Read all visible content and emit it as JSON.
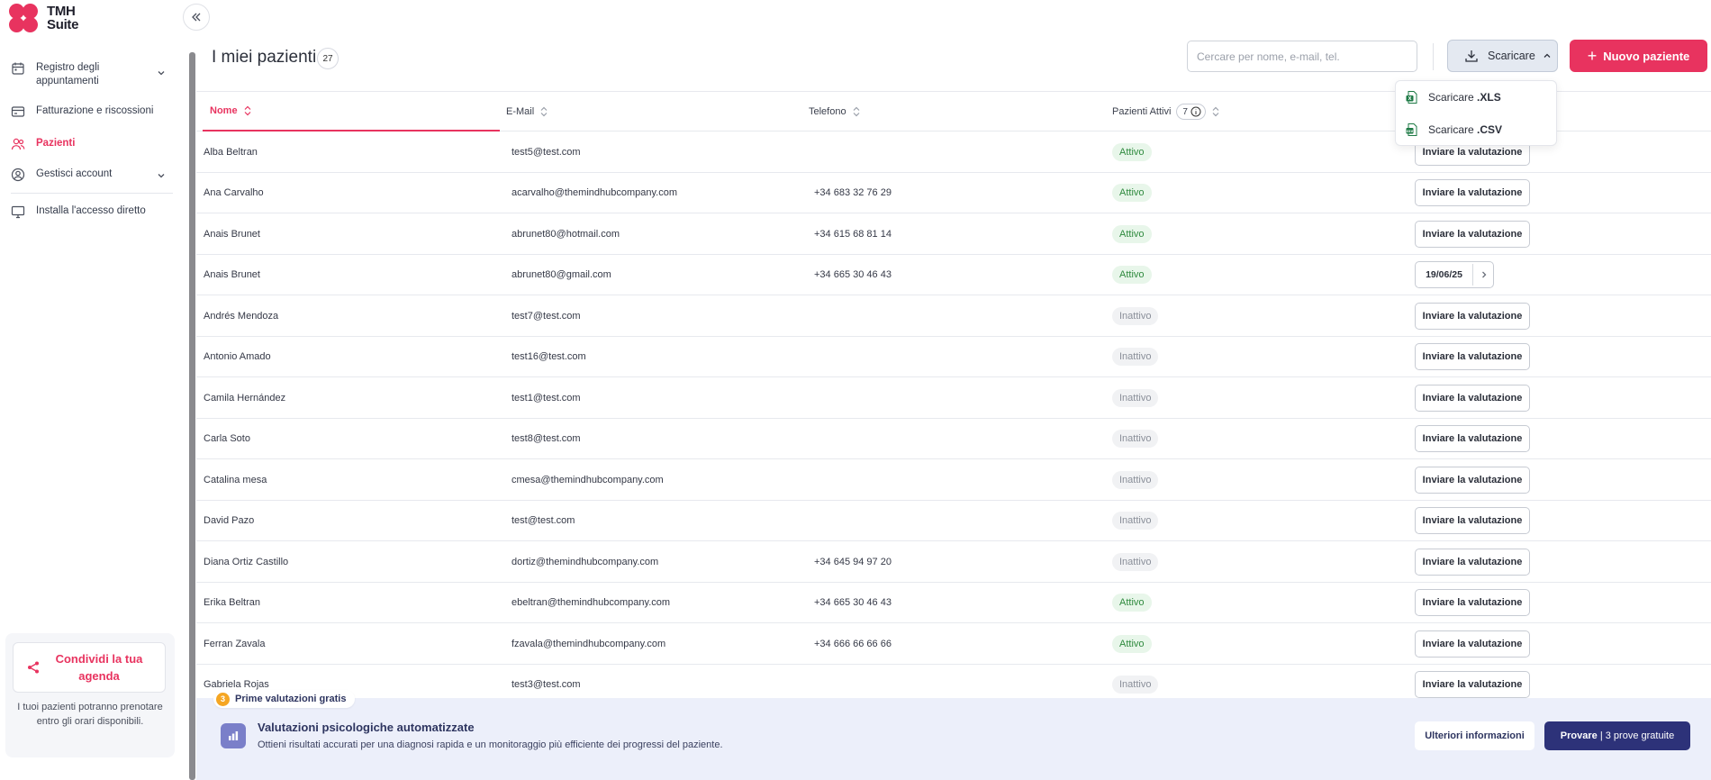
{
  "app": {
    "logo_line1": "TMH",
    "logo_line2": "Suite",
    "brand_color": "#e8335f"
  },
  "sidebar": {
    "items": [
      {
        "label": "Registro degli appuntamenti",
        "icon": "calendar-icon",
        "has_chevron": true
      },
      {
        "label": "Fatturazione e riscossioni",
        "icon": "card-icon",
        "has_chevron": false
      },
      {
        "label": "Pazienti",
        "icon": "users-icon",
        "active": true
      },
      {
        "label": "Gestisci account",
        "icon": "account-icon",
        "has_chevron": true
      },
      {
        "label": "Installa l'accesso diretto",
        "icon": "monitor-icon"
      }
    ],
    "share": {
      "title": "Condividi la tua agenda",
      "text": "I tuoi pazienti potranno prenotare entro gli orari disponibili."
    }
  },
  "header": {
    "title": "I miei pazienti",
    "count": "27",
    "search_placeholder": "Cercare per nome, e-mail, tel.",
    "download_label": "Scaricare",
    "new_patient_label": "Nuovo paziente"
  },
  "download_menu": {
    "items": [
      {
        "prefix": "Scaricare ",
        "ext": ".XLS",
        "icon": "xls-file-icon"
      },
      {
        "prefix": "Scaricare ",
        "ext": ".CSV",
        "icon": "csv-file-icon"
      }
    ]
  },
  "table": {
    "columns": {
      "name": "Nome",
      "email": "E-Mail",
      "phone": "Telefono",
      "active": "Pazienti Attivi",
      "active_count": "7"
    },
    "eval_label": "Inviare la valutazione",
    "rows": [
      {
        "name": "Alba Beltran",
        "email": "test5@test.com",
        "phone": "",
        "status": "Attivo",
        "active": true,
        "action": "eval"
      },
      {
        "name": "Ana Carvalho",
        "email": "acarvalho@themindhubcompany.com",
        "phone": "+34 683 32 76 29",
        "status": "Attivo",
        "active": true,
        "action": "eval"
      },
      {
        "name": "Anais Brunet",
        "email": "abrunet80@hotmail.com",
        "phone": "+34 615 68 81 14",
        "status": "Attivo",
        "active": true,
        "action": "eval"
      },
      {
        "name": "Anais Brunet",
        "email": "abrunet80@gmail.com",
        "phone": "+34 665 30 46 43",
        "status": "Attivo",
        "active": true,
        "action": "date",
        "date": "19/06/25"
      },
      {
        "name": "Andrés Mendoza",
        "email": "test7@test.com",
        "phone": "",
        "status": "Inattivo",
        "active": false,
        "action": "eval"
      },
      {
        "name": "Antonio Amado",
        "email": "test16@test.com",
        "phone": "",
        "status": "Inattivo",
        "active": false,
        "action": "eval"
      },
      {
        "name": "Camila Hernández",
        "email": "test1@test.com",
        "phone": "",
        "status": "Inattivo",
        "active": false,
        "action": "eval"
      },
      {
        "name": "Carla Soto",
        "email": "test8@test.com",
        "phone": "",
        "status": "Inattivo",
        "active": false,
        "action": "eval"
      },
      {
        "name": "Catalina mesa",
        "email": "cmesa@themindhubcompany.com",
        "phone": "",
        "status": "Inattivo",
        "active": false,
        "action": "eval"
      },
      {
        "name": "David Pazo",
        "email": "test@test.com",
        "phone": "",
        "status": "Inattivo",
        "active": false,
        "action": "eval"
      },
      {
        "name": "Diana Ortiz Castillo",
        "email": "dortiz@themindhubcompany.com",
        "phone": "+34 645 94 97 20",
        "status": "Inattivo",
        "active": false,
        "action": "eval"
      },
      {
        "name": "Erika Beltran",
        "email": "ebeltran@themindhubcompany.com",
        "phone": "+34 665 30 46 43",
        "status": "Attivo",
        "active": true,
        "action": "eval"
      },
      {
        "name": "Ferran Zavala",
        "email": "fzavala@themindhubcompany.com",
        "phone": "+34 666 66 66 66",
        "status": "Attivo",
        "active": true,
        "action": "eval"
      },
      {
        "name": "Gabriela Rojas",
        "email": "test3@test.com",
        "phone": "",
        "status": "Inattivo",
        "active": false,
        "action": "eval"
      }
    ]
  },
  "banner": {
    "pill_count": "3",
    "pill_text": "Prime valutazioni gratis",
    "title": "Valutazioni psicologiche automatizzate",
    "subtitle": "Ottieni risultati accurati per una diagnosi rapida e un monitoraggio più efficiente dei progressi del paziente.",
    "more_label": "Ulteriori informazioni",
    "try_label": "Provare",
    "try_suffix": " | 3 prove gratuite"
  }
}
